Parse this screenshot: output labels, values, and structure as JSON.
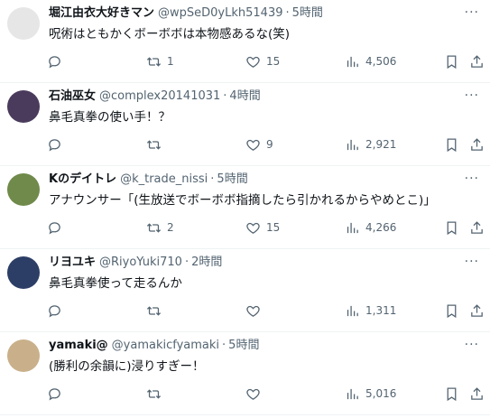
{
  "tweets": [
    {
      "name": "堀江由衣大好きマン",
      "handle": "@wpSeD0yLkh51439",
      "time": "5時間",
      "text": "呪術はともかくボーボボは本物感あるな(笑)",
      "replies": "",
      "retweets": "1",
      "likes": "15",
      "views": "4,506",
      "avatar_color": "#e6e6e6"
    },
    {
      "name": "石油巫女",
      "handle": "@complex20141031",
      "time": "4時間",
      "text": "鼻毛真拳の使い手！？",
      "replies": "",
      "retweets": "",
      "likes": "9",
      "views": "2,921",
      "avatar_color": "#4a3b5c"
    },
    {
      "name": "Kのデイトレ",
      "handle": "@k_trade_nissi",
      "time": "5時間",
      "text": "アナウンサー「(生放送でボーボボ指摘したら引かれるからやめとこ)」",
      "replies": "",
      "retweets": "2",
      "likes": "15",
      "views": "4,266",
      "avatar_color": "#6f8a4a"
    },
    {
      "name": "リヨユキ",
      "handle": "@RiyoYuki710",
      "time": "2時間",
      "text": "鼻毛真拳使って走るんか",
      "replies": "",
      "retweets": "",
      "likes": "",
      "views": "1,311",
      "avatar_color": "#2c3e66"
    },
    {
      "name": "yamaki@",
      "handle": "@yamakicfyamaki",
      "time": "5時間",
      "text": "(勝利の余韻に)浸りすぎー！",
      "replies": "",
      "retweets": "",
      "likes": "",
      "views": "5,016",
      "avatar_color": "#c9b08a"
    }
  ],
  "separator": "·"
}
